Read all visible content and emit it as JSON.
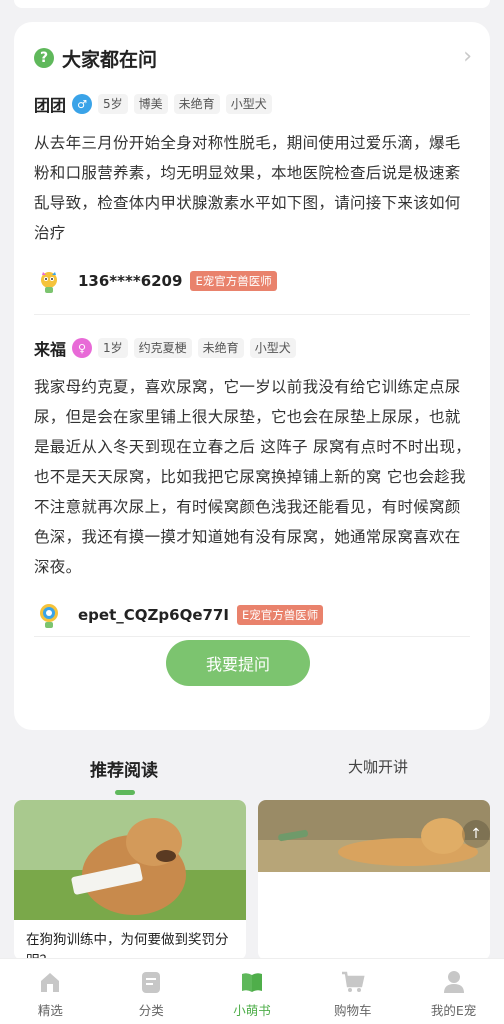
{
  "section": {
    "title": "大家都在问",
    "icon": "question-icon",
    "more_icon": "chevron-right-icon"
  },
  "questions": [
    {
      "pet_name": "团团",
      "gender": "male",
      "tags": [
        "5岁",
        "博美",
        "未绝育",
        "小型犬"
      ],
      "text": "从去年三月份开始全身对称性脱毛，期间使用过爱乐滴，爆毛粉和口服营养素，均无明显效果，本地医院检查后说是极速紊乱导致，检查体内甲状腺激素水平如下图，请问接下来该如何治疗",
      "vet_name": "136****6209",
      "vet_badge": "E宠官方兽医师"
    },
    {
      "pet_name": "来福",
      "gender": "female",
      "tags": [
        "1岁",
        "约克夏梗",
        "未绝育",
        "小型犬"
      ],
      "text": "我家母约克夏，喜欢尿窝，它一岁以前我没有给它训练定点尿尿，但是会在家里铺上很大尿垫，它也会在尿垫上尿尿，也就是最近从入冬天到现在立春之后 这阵子 尿窝有点时不时出现，也不是天天尿窝，比如我把它尿窝换掉铺上新的窝 它也会趁我不注意就再次尿上，有时候窝颜色浅我还能看见，有时候窝颜色深，我还有摸一摸才知道她有没有尿窝，她通常尿窝喜欢在深夜。",
      "vet_name": "epet_CQZp6Qe77I",
      "vet_badge": "E宠官方兽医师"
    }
  ],
  "ask_button": "我要提问",
  "tabs": {
    "active": "推荐阅读",
    "inactive": "大咖开讲"
  },
  "articles": [
    {
      "title": "在狗狗训练中，为何要做到奖罚分明？"
    },
    {
      "title": ""
    }
  ],
  "tabbar": [
    {
      "label": "精选",
      "icon": "home-icon"
    },
    {
      "label": "分类",
      "icon": "category-icon"
    },
    {
      "label": "小萌书",
      "icon": "book-icon",
      "active": true
    },
    {
      "label": "购物车",
      "icon": "cart-icon"
    },
    {
      "label": "我的E宠",
      "icon": "profile-icon"
    }
  ],
  "colors": {
    "accent": "#5fb85b",
    "badge": "#e9826c",
    "male": "#3aa3e8",
    "female": "#e86ad7"
  }
}
